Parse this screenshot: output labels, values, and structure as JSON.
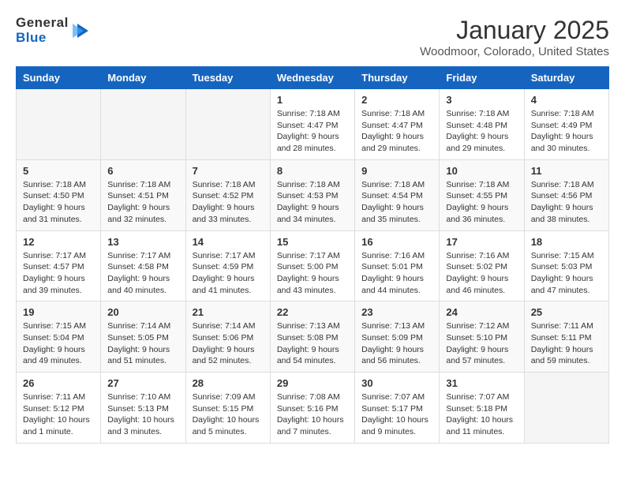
{
  "header": {
    "logo_general": "General",
    "logo_blue": "Blue",
    "month_title": "January 2025",
    "location": "Woodmoor, Colorado, United States"
  },
  "weekdays": [
    "Sunday",
    "Monday",
    "Tuesday",
    "Wednesday",
    "Thursday",
    "Friday",
    "Saturday"
  ],
  "weeks": [
    [
      {
        "day": "",
        "info": ""
      },
      {
        "day": "",
        "info": ""
      },
      {
        "day": "",
        "info": ""
      },
      {
        "day": "1",
        "info": "Sunrise: 7:18 AM\nSunset: 4:47 PM\nDaylight: 9 hours\nand 28 minutes."
      },
      {
        "day": "2",
        "info": "Sunrise: 7:18 AM\nSunset: 4:47 PM\nDaylight: 9 hours\nand 29 minutes."
      },
      {
        "day": "3",
        "info": "Sunrise: 7:18 AM\nSunset: 4:48 PM\nDaylight: 9 hours\nand 29 minutes."
      },
      {
        "day": "4",
        "info": "Sunrise: 7:18 AM\nSunset: 4:49 PM\nDaylight: 9 hours\nand 30 minutes."
      }
    ],
    [
      {
        "day": "5",
        "info": "Sunrise: 7:18 AM\nSunset: 4:50 PM\nDaylight: 9 hours\nand 31 minutes."
      },
      {
        "day": "6",
        "info": "Sunrise: 7:18 AM\nSunset: 4:51 PM\nDaylight: 9 hours\nand 32 minutes."
      },
      {
        "day": "7",
        "info": "Sunrise: 7:18 AM\nSunset: 4:52 PM\nDaylight: 9 hours\nand 33 minutes."
      },
      {
        "day": "8",
        "info": "Sunrise: 7:18 AM\nSunset: 4:53 PM\nDaylight: 9 hours\nand 34 minutes."
      },
      {
        "day": "9",
        "info": "Sunrise: 7:18 AM\nSunset: 4:54 PM\nDaylight: 9 hours\nand 35 minutes."
      },
      {
        "day": "10",
        "info": "Sunrise: 7:18 AM\nSunset: 4:55 PM\nDaylight: 9 hours\nand 36 minutes."
      },
      {
        "day": "11",
        "info": "Sunrise: 7:18 AM\nSunset: 4:56 PM\nDaylight: 9 hours\nand 38 minutes."
      }
    ],
    [
      {
        "day": "12",
        "info": "Sunrise: 7:17 AM\nSunset: 4:57 PM\nDaylight: 9 hours\nand 39 minutes."
      },
      {
        "day": "13",
        "info": "Sunrise: 7:17 AM\nSunset: 4:58 PM\nDaylight: 9 hours\nand 40 minutes."
      },
      {
        "day": "14",
        "info": "Sunrise: 7:17 AM\nSunset: 4:59 PM\nDaylight: 9 hours\nand 41 minutes."
      },
      {
        "day": "15",
        "info": "Sunrise: 7:17 AM\nSunset: 5:00 PM\nDaylight: 9 hours\nand 43 minutes."
      },
      {
        "day": "16",
        "info": "Sunrise: 7:16 AM\nSunset: 5:01 PM\nDaylight: 9 hours\nand 44 minutes."
      },
      {
        "day": "17",
        "info": "Sunrise: 7:16 AM\nSunset: 5:02 PM\nDaylight: 9 hours\nand 46 minutes."
      },
      {
        "day": "18",
        "info": "Sunrise: 7:15 AM\nSunset: 5:03 PM\nDaylight: 9 hours\nand 47 minutes."
      }
    ],
    [
      {
        "day": "19",
        "info": "Sunrise: 7:15 AM\nSunset: 5:04 PM\nDaylight: 9 hours\nand 49 minutes."
      },
      {
        "day": "20",
        "info": "Sunrise: 7:14 AM\nSunset: 5:05 PM\nDaylight: 9 hours\nand 51 minutes."
      },
      {
        "day": "21",
        "info": "Sunrise: 7:14 AM\nSunset: 5:06 PM\nDaylight: 9 hours\nand 52 minutes."
      },
      {
        "day": "22",
        "info": "Sunrise: 7:13 AM\nSunset: 5:08 PM\nDaylight: 9 hours\nand 54 minutes."
      },
      {
        "day": "23",
        "info": "Sunrise: 7:13 AM\nSunset: 5:09 PM\nDaylight: 9 hours\nand 56 minutes."
      },
      {
        "day": "24",
        "info": "Sunrise: 7:12 AM\nSunset: 5:10 PM\nDaylight: 9 hours\nand 57 minutes."
      },
      {
        "day": "25",
        "info": "Sunrise: 7:11 AM\nSunset: 5:11 PM\nDaylight: 9 hours\nand 59 minutes."
      }
    ],
    [
      {
        "day": "26",
        "info": "Sunrise: 7:11 AM\nSunset: 5:12 PM\nDaylight: 10 hours\nand 1 minute."
      },
      {
        "day": "27",
        "info": "Sunrise: 7:10 AM\nSunset: 5:13 PM\nDaylight: 10 hours\nand 3 minutes."
      },
      {
        "day": "28",
        "info": "Sunrise: 7:09 AM\nSunset: 5:15 PM\nDaylight: 10 hours\nand 5 minutes."
      },
      {
        "day": "29",
        "info": "Sunrise: 7:08 AM\nSunset: 5:16 PM\nDaylight: 10 hours\nand 7 minutes."
      },
      {
        "day": "30",
        "info": "Sunrise: 7:07 AM\nSunset: 5:17 PM\nDaylight: 10 hours\nand 9 minutes."
      },
      {
        "day": "31",
        "info": "Sunrise: 7:07 AM\nSunset: 5:18 PM\nDaylight: 10 hours\nand 11 minutes."
      },
      {
        "day": "",
        "info": ""
      }
    ]
  ]
}
